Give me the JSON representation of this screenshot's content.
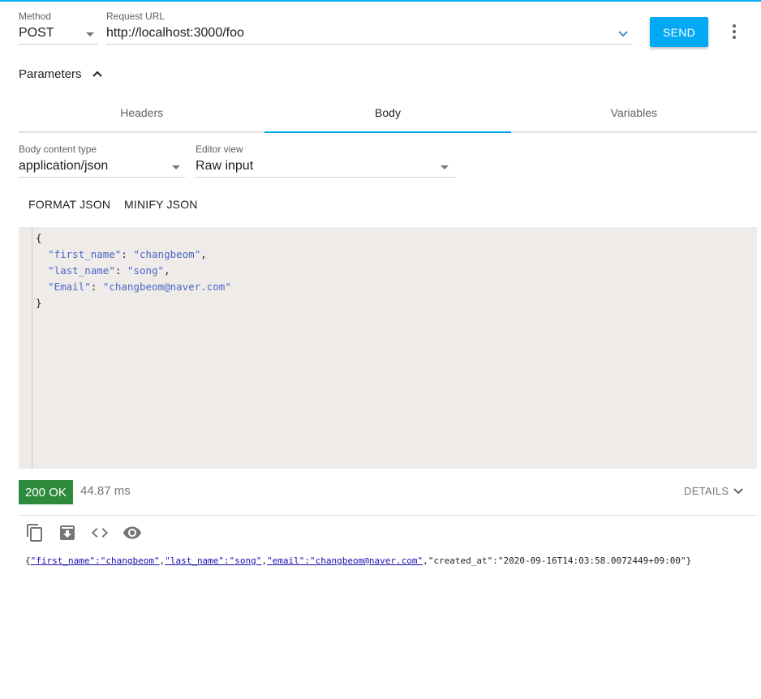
{
  "request": {
    "method_label": "Method",
    "method_value": "POST",
    "url_label": "Request URL",
    "url_value": "http://localhost:3000/foo",
    "send_label": "SEND"
  },
  "parameters": {
    "label": "Parameters"
  },
  "tabs": [
    {
      "label": "Headers",
      "active": false
    },
    {
      "label": "Body",
      "active": true
    },
    {
      "label": "Variables",
      "active": false
    }
  ],
  "body": {
    "content_type_label": "Body content type",
    "content_type_value": "application/json",
    "editor_view_label": "Editor view",
    "editor_view_value": "Raw input",
    "format_label": "FORMAT JSON",
    "minify_label": "MINIFY JSON",
    "code": {
      "open": "{",
      "close": "}",
      "lines": [
        {
          "key": "\"first_name\"",
          "value": "\"changbeom\"",
          "comma": ","
        },
        {
          "key": "\"last_name\"",
          "value": "\"song\"",
          "comma": ","
        },
        {
          "key": "\"Email\"",
          "value": "\"changbeom@naver.com\"",
          "comma": ""
        }
      ]
    }
  },
  "response": {
    "status": "200 OK",
    "time": "44.87 ms",
    "details_label": "DETAILS",
    "raw": {
      "open": "{",
      "link1": "\"first_name\":\"changbeom\"",
      "c1": ",",
      "link2": "\"last_name\":\"song\"",
      "c2": ",",
      "link3": "\"email\":\"changbeom@naver.com\"",
      "rest": ",\"created_at\":\"2020-09-16T14:03:58.0072449+09:00\"}"
    }
  },
  "colors": {
    "accent": "#03a9f4",
    "success": "#2e8b3d",
    "editor_bg": "#eeebe8"
  },
  "icons": [
    "chevron-down-icon",
    "chevron-up-icon",
    "more-vert-icon",
    "copy-icon",
    "save-icon",
    "code-icon",
    "eye-icon"
  ]
}
